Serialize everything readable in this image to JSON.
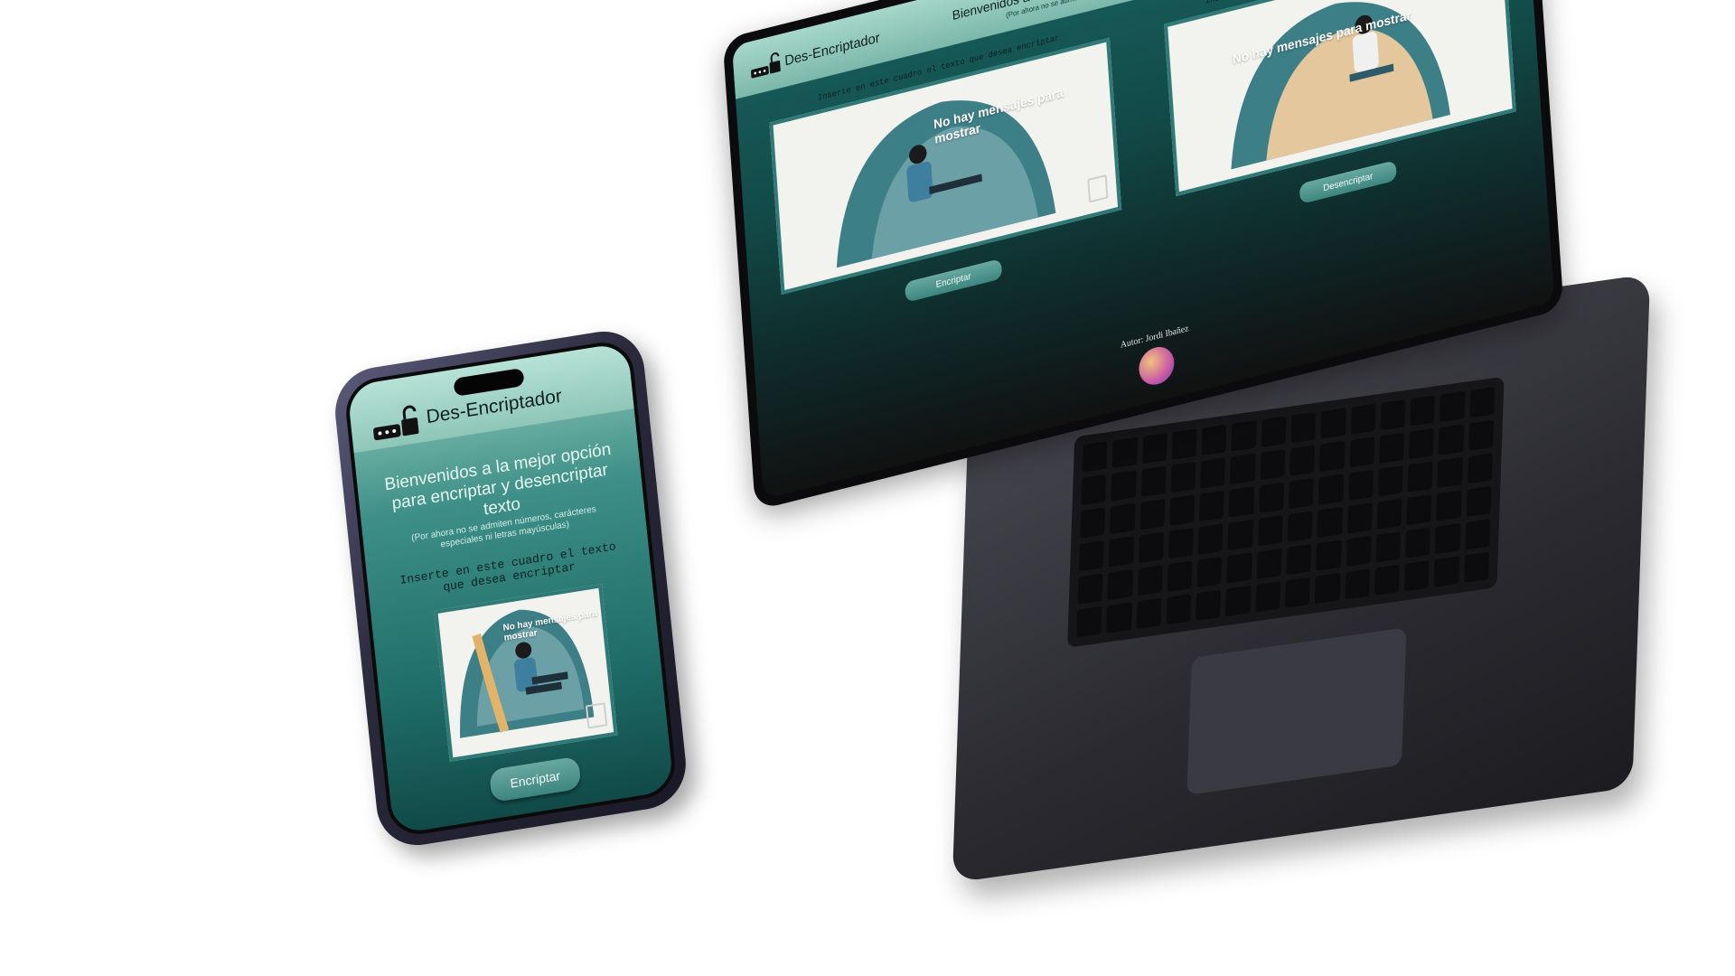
{
  "app": {
    "brand": "Des-Encriptador",
    "welcome": "Bienvenidos a la mejor opción para encriptar y desencriptar texto",
    "note": "(Por ahora no se admiten números, carácteres especiales ni letras mayúsculas)"
  },
  "phone": {
    "prompt": "Inserte en este cuadro el texto que desea encriptar",
    "illustration_text": "No hay mensajes para mostrar",
    "button": "Encriptar"
  },
  "laptop": {
    "left": {
      "prompt": "Inserte en este cuadro el texto que desea encriptar",
      "illustration_text": "No hay mensajes para mostrar",
      "button": "Encriptar"
    },
    "right": {
      "prompt": "Inserte en este cuadro el texto que desea desencriptar",
      "illustration_text": "No hay mensajes para mostrar",
      "button": "Desencriptar"
    },
    "footer": "Autor: Jordi Ibañez"
  },
  "colors": {
    "header_mint": "#a6d7c9",
    "teal_dark": "#124947",
    "button_teal": "#3d8680"
  },
  "icons": [
    "padlock-icon",
    "password-field-icon",
    "document-icon",
    "avatar-image"
  ]
}
